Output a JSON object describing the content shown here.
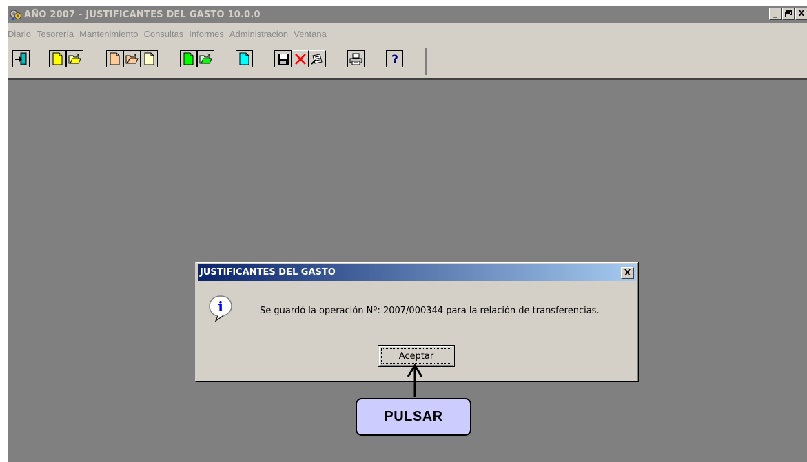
{
  "window": {
    "title": "AÑO 2007 - JUSTIFICANTES DEL GASTO 10.0.0",
    "app_icon": "gear-app-icon",
    "controls": [
      "minimize-icon",
      "restore-icon",
      "close-icon"
    ],
    "minimize_glyph": "_",
    "restore_glyph": "❐",
    "close_glyph": "X"
  },
  "menu": {
    "items": [
      "Diario",
      "Tesorería",
      "Mantenimiento",
      "Consultas",
      "Informes",
      "Administracion",
      "Ventana"
    ]
  },
  "toolbar": {
    "buttons": [
      {
        "icon": "exit-door-icon"
      },
      {
        "icon": "new-document-yellow-icon"
      },
      {
        "icon": "open-folder-icon"
      },
      {
        "icon": "new-document-orange-icon"
      },
      {
        "icon": "open-folder-icon"
      },
      {
        "icon": "blank-document-icon"
      },
      {
        "icon": "new-document-green-icon"
      },
      {
        "icon": "open-folder-icon"
      },
      {
        "icon": "new-document-cyan-icon"
      },
      {
        "icon": "save-disk-icon"
      },
      {
        "icon": "delete-x-icon"
      },
      {
        "icon": "edit-notepad-icon"
      },
      {
        "icon": "print-icon"
      },
      {
        "icon": "help-question-icon"
      }
    ]
  },
  "dialog": {
    "title": "JUSTIFICANTES DEL GASTO",
    "close_glyph": "X",
    "icon": "info-icon",
    "message": "Se guardó la operación Nº: 2007/000344 para la relación de transferencias.",
    "ok_label": "Aceptar"
  },
  "callout": {
    "label": "PULSAR",
    "arrow_icon": "arrow-up-icon"
  },
  "colors": {
    "mdi_background": "#808080",
    "title_active_start": "#0a246a",
    "title_active_end": "#a6caf0",
    "callout_fill": "#ccccff",
    "face": "#d4d0c8"
  }
}
